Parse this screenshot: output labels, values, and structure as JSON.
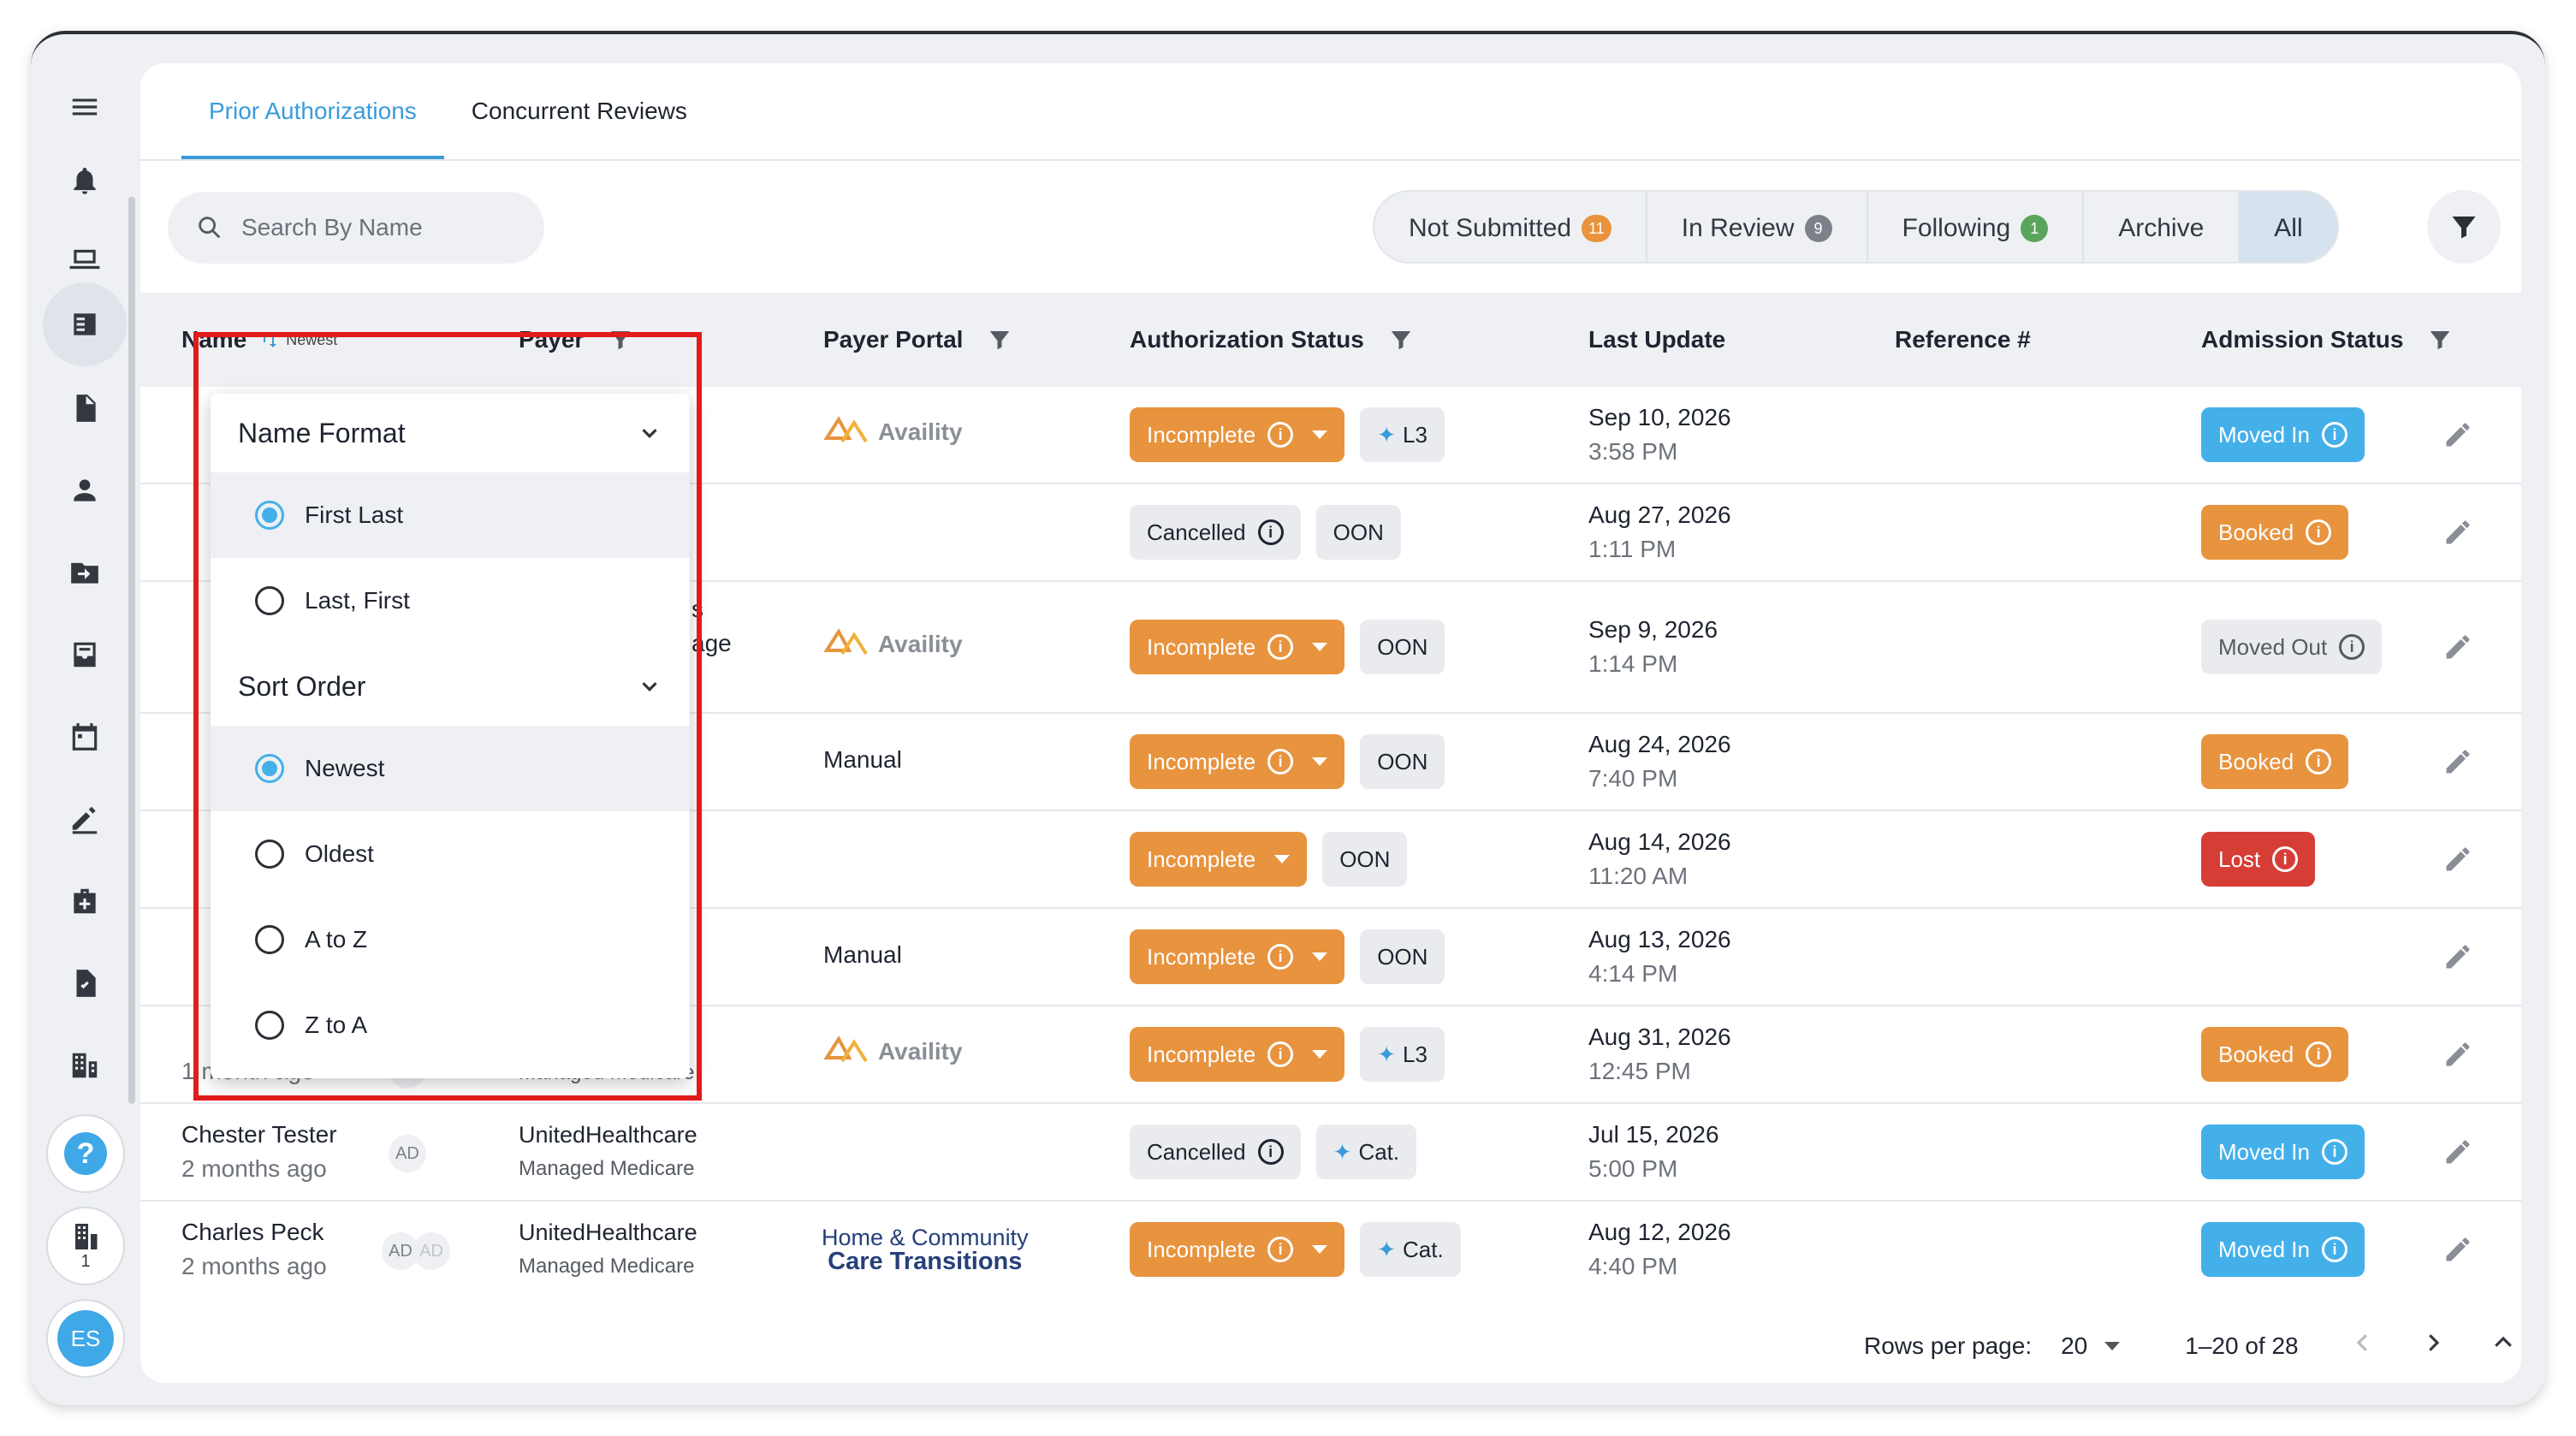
{
  "tabs": [
    {
      "label": "Prior Authorizations",
      "active": true
    },
    {
      "label": "Concurrent Reviews",
      "active": false
    }
  ],
  "search": {
    "placeholder": "Search By Name",
    "value": ""
  },
  "filters": [
    {
      "label": "Not Submitted",
      "count": "11",
      "color": "#e8933e"
    },
    {
      "label": "In Review",
      "count": "9",
      "color": "#7d828a"
    },
    {
      "label": "Following",
      "count": "1",
      "color": "#5aa55c"
    },
    {
      "label": "Archive",
      "count": ""
    },
    {
      "label": "All",
      "count": "",
      "selected": true
    }
  ],
  "columns": {
    "name": "Name",
    "name_sort": "Newest",
    "payer": "Payer",
    "payer_portal": "Payer Portal",
    "auth_status": "Authorization Status",
    "last_update": "Last Update",
    "reference": "Reference #",
    "admission_status": "Admission Status"
  },
  "dropdown": {
    "name_format_title": "Name Format",
    "name_format_options": [
      "First Last",
      "Last, First"
    ],
    "name_format_selected": "First Last",
    "sort_order_title": "Sort Order",
    "sort_order_options": [
      "Newest",
      "Oldest",
      "A to Z",
      "Z to A"
    ],
    "sort_order_selected": "Newest"
  },
  "rows": [
    {
      "portal": "Availity",
      "auth": "Incomplete",
      "tag": "L3",
      "date": "Sep 10, 2026",
      "time": "3:58 PM",
      "admission": "Moved In"
    },
    {
      "portal": "",
      "auth": "Cancelled",
      "tag": "OON",
      "date": "Aug 27, 2026",
      "time": "1:11 PM",
      "admission": "Booked"
    },
    {
      "payer_fragment_1": "s",
      "payer_fragment_2": "age",
      "portal": "Availity",
      "auth": "Incomplete",
      "tag": "OON",
      "date": "Sep 9, 2026",
      "time": "1:14 PM",
      "admission": "Moved Out"
    },
    {
      "portal": "Manual",
      "auth": "Incomplete",
      "tag": "OON",
      "date": "Aug 24, 2026",
      "time": "7:40 PM",
      "admission": "Booked"
    },
    {
      "portal": "",
      "auth": "Incomplete",
      "tag": "OON",
      "date": "Aug 14, 2026",
      "time": "11:20 AM",
      "admission": "Lost"
    },
    {
      "portal": "Manual",
      "auth": "Incomplete",
      "tag": "OON",
      "date": "Aug 13, 2026",
      "time": "4:14 PM",
      "admission": ""
    },
    {
      "name_sub": "1 month ago",
      "initials": "AD",
      "payer_sub": "Managed Medicare",
      "portal": "Availity",
      "auth": "Incomplete",
      "tag": "L3",
      "date": "Aug 31, 2026",
      "time": "12:45 PM",
      "admission": "Booked"
    },
    {
      "name": "Chester Tester",
      "name_sub": "2 months ago",
      "initials": "AD",
      "payer": "UnitedHealthcare",
      "payer_sub": "Managed Medicare",
      "portal": "",
      "auth": "Cancelled",
      "tag": "Cat.",
      "date": "Jul 15, 2026",
      "time": "5:00 PM",
      "admission": "Moved In"
    },
    {
      "name": "Charles Peck",
      "name_sub": "2 months ago",
      "initials": "AD",
      "initials2": "AD",
      "payer": "UnitedHealthcare",
      "payer_sub": "Managed Medicare",
      "portal_l1": "Home & Community",
      "portal_l2": "Care Transitions",
      "auth": "Incomplete",
      "tag": "Cat.",
      "date": "Aug 12, 2026",
      "time": "4:40 PM",
      "admission": "Moved In"
    }
  ],
  "footer": {
    "rows_per_page_label": "Rows per page:",
    "rows_per_page": "20",
    "range": "1–20 of 28"
  },
  "sidebar": {
    "building_count": "1",
    "avatar": "ES"
  }
}
